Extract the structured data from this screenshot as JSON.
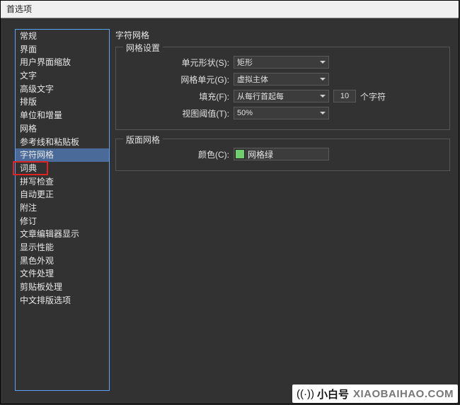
{
  "window": {
    "title": "首选项"
  },
  "sidebar": {
    "items": [
      {
        "label": "常规"
      },
      {
        "label": "界面"
      },
      {
        "label": "用户界面缩放"
      },
      {
        "label": "文字"
      },
      {
        "label": "高级文字"
      },
      {
        "label": "排版"
      },
      {
        "label": "单位和增量"
      },
      {
        "label": "网格"
      },
      {
        "label": "参考线和粘贴板"
      },
      {
        "label": "字符网格"
      },
      {
        "label": "词典"
      },
      {
        "label": "拼写检查"
      },
      {
        "label": "自动更正"
      },
      {
        "label": "附注"
      },
      {
        "label": "修订"
      },
      {
        "label": "文章编辑器显示"
      },
      {
        "label": "显示性能"
      },
      {
        "label": "黑色外观"
      },
      {
        "label": "文件处理"
      },
      {
        "label": "剪贴板处理"
      },
      {
        "label": "中文排版选项"
      }
    ],
    "selected_index": 9,
    "highlighted_index": 10
  },
  "content": {
    "heading": "字符网格",
    "grid_settings": {
      "legend": "网格设置",
      "unit_shape": {
        "label": "单元形状(S):",
        "value": "矩形"
      },
      "grid_unit": {
        "label": "网格单元(G):",
        "value": "虚拟主体"
      },
      "fill": {
        "label": "填充(F):",
        "value": "从每行首起每",
        "count": "10",
        "suffix": "个字符"
      },
      "view_thresh": {
        "label": "视图阈值(T):",
        "value": "50%"
      }
    },
    "layout_grid": {
      "legend": "版面网格",
      "color": {
        "label": "颜色(C):",
        "swatch": "#6fcf6f",
        "name": "网格绿"
      }
    }
  },
  "watermark": {
    "text": "XIAOBAIHAO.COM"
  },
  "footer": {
    "icon": "((·))",
    "brand": "小白号",
    "domain": "XIAOBAIHAO.COM"
  }
}
